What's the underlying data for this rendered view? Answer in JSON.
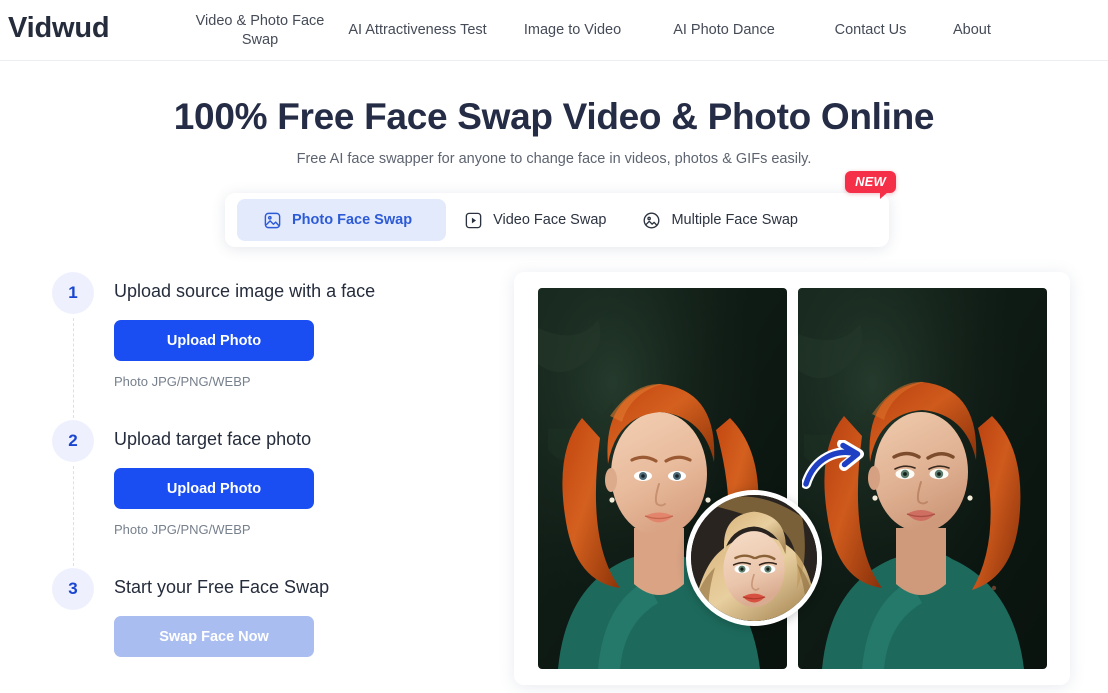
{
  "header": {
    "logo": "Vidwud",
    "nav": [
      {
        "label": "Video & Photo Face Swap"
      },
      {
        "label": "AI Attractiveness Test"
      },
      {
        "label": "Image to Video"
      },
      {
        "label": "AI Photo Dance"
      },
      {
        "label": "Contact Us"
      },
      {
        "label": "About"
      }
    ]
  },
  "hero": {
    "title": "100% Free Face Swap Video & Photo Online",
    "subtitle": "Free AI face swapper for anyone to change face in videos, photos & GIFs easily."
  },
  "tabs": {
    "badge": "NEW",
    "items": [
      {
        "label": "Photo Face Swap",
        "icon": "image-square-icon",
        "active": true
      },
      {
        "label": "Video Face Swap",
        "icon": "video-play-icon",
        "active": false
      },
      {
        "label": "Multiple Face Swap",
        "icon": "image-circle-icon",
        "active": false
      }
    ]
  },
  "steps": [
    {
      "number": "1",
      "title": "Upload source image with a face",
      "button": "Upload Photo",
      "hint": "Photo JPG/PNG/WEBP",
      "disabled": false
    },
    {
      "number": "2",
      "title": "Upload target face photo",
      "button": "Upload Photo",
      "hint": "Photo JPG/PNG/WEBP",
      "disabled": false
    },
    {
      "number": "3",
      "title": "Start your Free Face Swap",
      "button": "Swap Face Now",
      "hint": "",
      "disabled": true
    }
  ],
  "preview": {
    "before_label": "source photo of red-haired woman",
    "after_label": "result photo with swapped face",
    "inset_label": "target blonde face thumbnail",
    "arrow_label": "swap direction arrow"
  },
  "colors": {
    "accent_blue": "#1b4ef2",
    "accent_blue_soft": "#aabdf0",
    "tab_active_bg": "#e3eafc",
    "tab_active_text": "#2d5bd7",
    "badge_red": "#f62f48",
    "step_circle_bg": "#eef1fd",
    "heading": "#252c45",
    "muted_text": "#77808d"
  }
}
